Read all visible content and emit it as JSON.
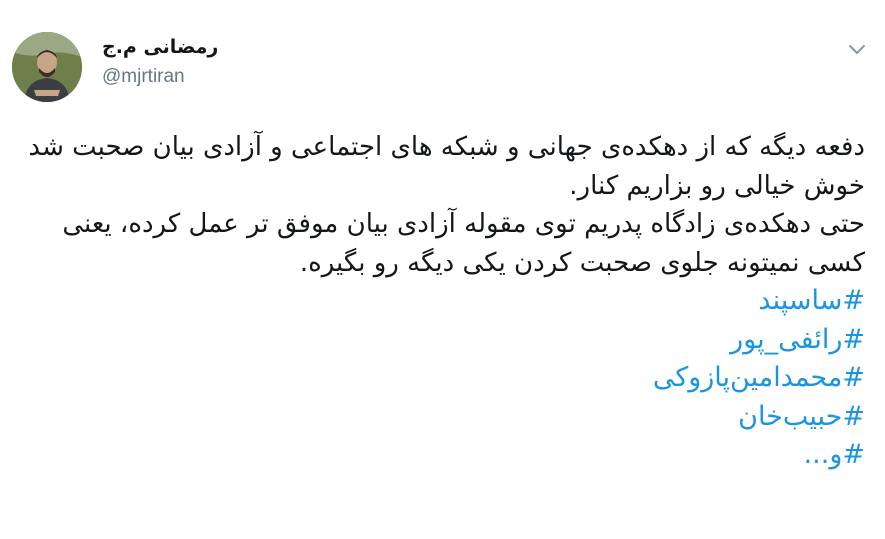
{
  "author": {
    "display_name": "رمضانی م.ج",
    "handle": "@mjrtiran",
    "avatar_icon": "profile-photo"
  },
  "menu": {
    "caret_icon": "chevron-down-icon"
  },
  "tweet": {
    "paragraphs": [
      "دفعه دیگه که از دهکده‌ی جهانی و شبکه های اجتماعی و آزادی بیان صحبت شد خوش خیالی رو بزاریم کنار.",
      "حتی دهکده‌ی زادگاه پدریم توی مقوله آزادی بیان موفق تر عمل کرده، یعنی کسی نمیتونه جلوی صحبت کردن یکی دیگه رو بگیره."
    ],
    "hashtags": [
      "#ساسپند",
      "#رائفی_پور",
      "#محمدامین‌پازوکی",
      "#حبیب‌خان",
      "#و..."
    ],
    "link_color": "#1b95e0",
    "text_color": "#14171a",
    "handle_color": "#657786"
  }
}
